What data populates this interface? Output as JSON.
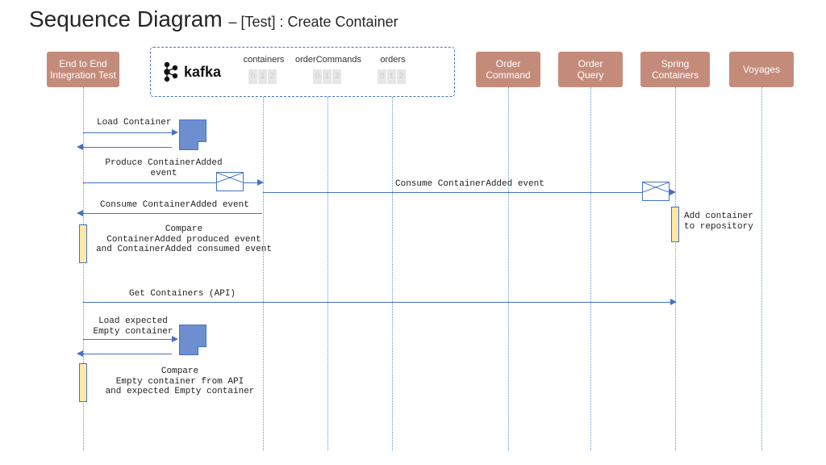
{
  "title_main": "Sequence Diagram",
  "title_sub": "– [Test] : Create Container",
  "participants": {
    "e2e": "End to End\nIntegration Test",
    "kafka": "kafka",
    "orderCmd": "Order\nCommand",
    "orderQry": "Order\nQuery",
    "spring": "Spring\nContainers",
    "voyages": "Voyages"
  },
  "topics": {
    "t1": "containers",
    "t2": "orderCommands",
    "t3": "orders"
  },
  "partitions": [
    "0",
    "1",
    "2"
  ],
  "messages": {
    "m1": "Load Container",
    "m2": "Produce ContainerAdded\nevent",
    "m3": "Consume ContainerAdded event",
    "m4": "Consume ContainerAdded event",
    "m5": "Compare\nContainerAdded produced event\nand ContainerAdded consumed event",
    "m6": "Get Containers (API)",
    "m7": "Load expected\nEmpty container",
    "m8": "Compare\nEmpty container from API\nand expected Empty container",
    "m9": "Add container\nto repository"
  }
}
